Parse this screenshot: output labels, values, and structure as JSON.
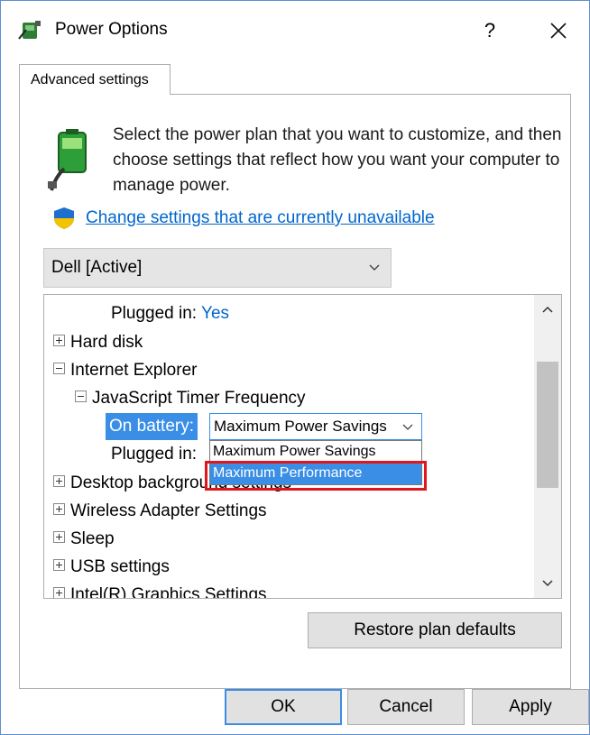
{
  "window": {
    "title": "Power Options",
    "help_label": "?",
    "tab_label": "Advanced settings"
  },
  "description": "Select the power plan that you want to customize, and then choose settings that reflect how you want your computer to manage power.",
  "change_link": "Change settings that are currently unavailable",
  "plan_select": {
    "value": "Dell [Active]"
  },
  "tree": {
    "plugged_in_top": {
      "label": "Plugged in:",
      "value": "Yes"
    },
    "hard_disk": "Hard disk",
    "internet_explorer": "Internet Explorer",
    "js_timer": "JavaScript Timer Frequency",
    "on_battery": {
      "label": "On battery:",
      "value": "Maximum Power Savings"
    },
    "plugged_in": {
      "label": "Plugged in:"
    },
    "dropdown_options": [
      "Maximum Power Savings",
      "Maximum Performance"
    ],
    "desktop_background": "Desktop background settings",
    "wireless": "Wireless Adapter Settings",
    "sleep": "Sleep",
    "usb": "USB settings",
    "graphics": "Intel(R) Graphics Settings"
  },
  "buttons": {
    "restore": "Restore plan defaults",
    "ok": "OK",
    "cancel": "Cancel",
    "apply": "Apply"
  },
  "colors": {
    "accent": "#3a8ee6",
    "link": "#0066cc",
    "highlight_box": "#e0161b"
  }
}
